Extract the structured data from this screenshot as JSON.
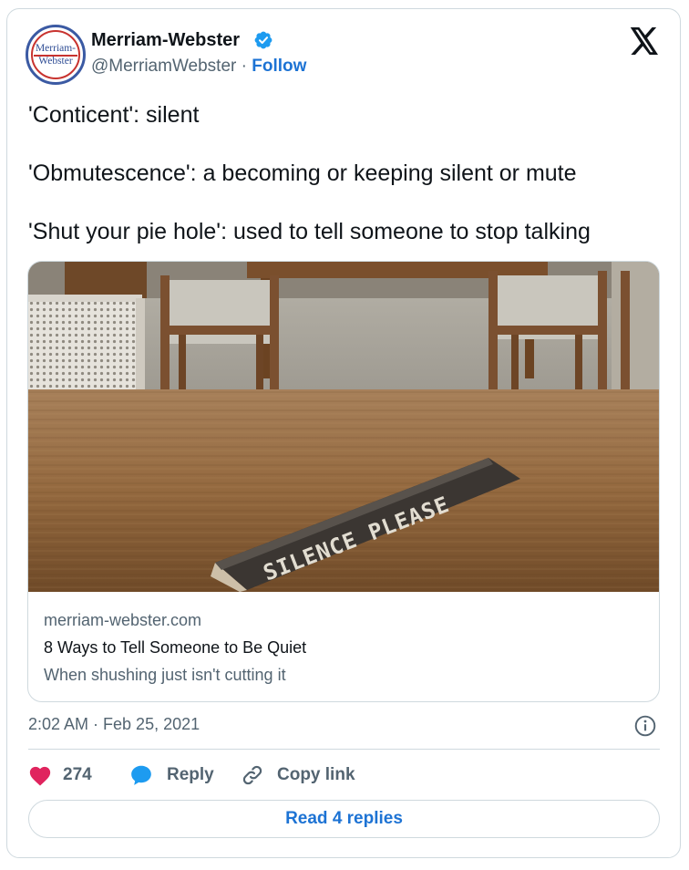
{
  "author": {
    "avatar_line1": "Merriam-",
    "avatar_line2": "Webster",
    "name": "Merriam-Webster",
    "verified_icon": "verified-badge-icon",
    "handle": "@MerriamWebster",
    "separator": " · ",
    "follow_label": "Follow"
  },
  "platform_logo": "x-logo-icon",
  "tweet": {
    "lines": [
      "'Conticent': silent",
      "'Obmutescence': a becoming or keeping silent or mute",
      "'Shut your pie hole': used to tell someone to stop talking"
    ]
  },
  "link_card": {
    "image_sign_text": "SILENCE PLEASE",
    "domain": "merriam-webster.com",
    "title": "8 Ways to Tell Someone to Be Quiet",
    "description": "When shushing just isn't cutting it"
  },
  "timestamp": "2:02 AM · Feb 25, 2021",
  "actions": {
    "like_count": "274",
    "reply_label": "Reply",
    "copy_label": "Copy link"
  },
  "read_replies_label": "Read 4 replies",
  "colors": {
    "like": "#e0245e",
    "reply": "#1d9bf0",
    "link": "#1d73d4",
    "secondary_text": "#536471",
    "border": "#cfd9de"
  }
}
